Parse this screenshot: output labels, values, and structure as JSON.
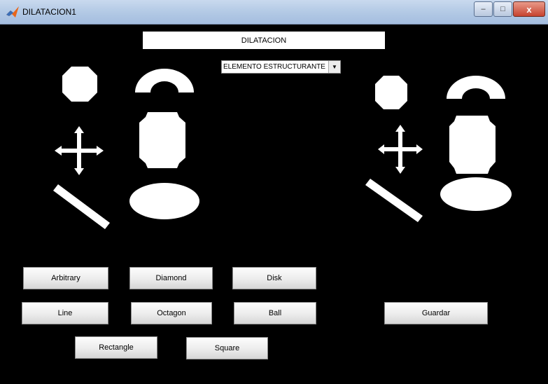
{
  "window": {
    "title": "DILATACION1",
    "controls": {
      "minimize": "–",
      "maximize": "□",
      "close": "x"
    }
  },
  "header": {
    "label": "DILATACION"
  },
  "popup": {
    "selected": "ELEMENTO ESTRUCTURANTE",
    "arrow": "▼"
  },
  "axes": {
    "left": "original-shapes-image",
    "right": "dilated-shapes-image"
  },
  "buttons": {
    "arbitrary": "Arbitrary",
    "diamond": "Diamond",
    "disk": "Disk",
    "line": "Line",
    "octagon": "Octagon",
    "ball": "Ball",
    "rectangle": "Rectangle",
    "square": "Square",
    "guardar": "Guardar"
  },
  "colors": {
    "background": "#000000",
    "shape": "#ffffff",
    "titlebar": "#b5cbe6"
  }
}
